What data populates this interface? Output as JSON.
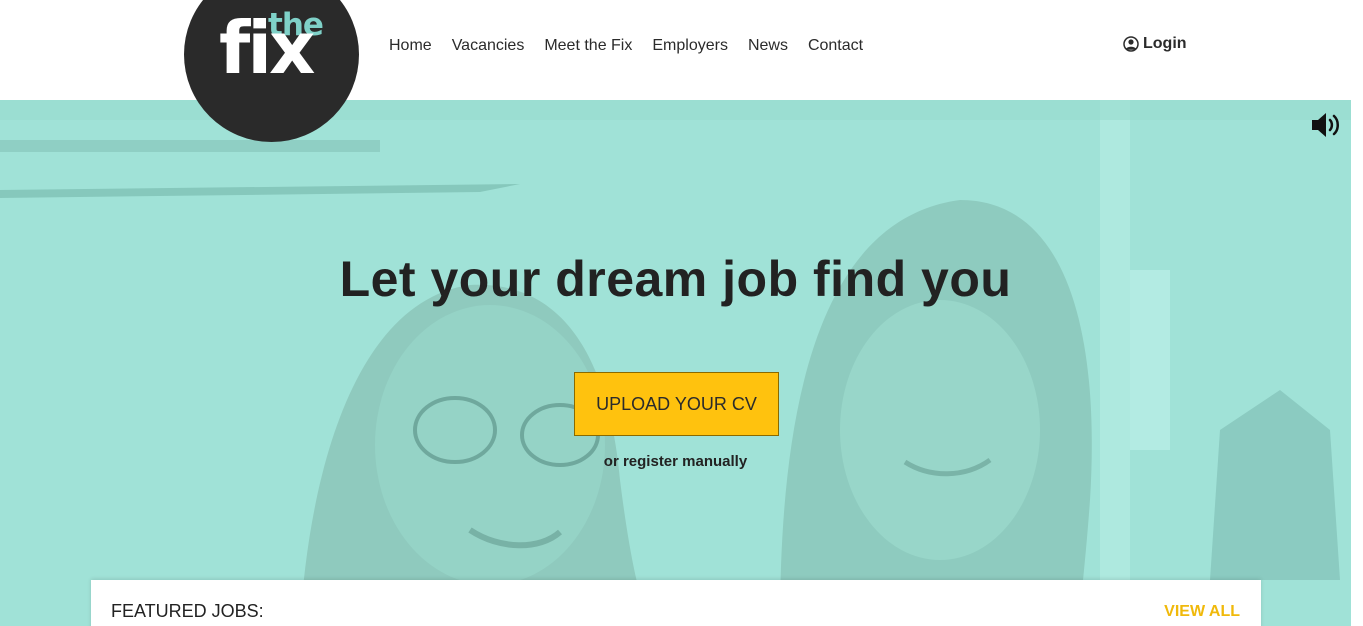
{
  "brand": {
    "logo_word_small": "the",
    "logo_word_large": "fix"
  },
  "nav": {
    "items": [
      {
        "label": "Home"
      },
      {
        "label": "Vacancies"
      },
      {
        "label": "Meet the Fix"
      },
      {
        "label": "Employers"
      },
      {
        "label": "News"
      },
      {
        "label": "Contact"
      }
    ]
  },
  "header": {
    "login_label": "Login",
    "login_icon": "user-circle-icon"
  },
  "hero": {
    "headline": "Let your dream job find you",
    "cta_label": "UPLOAD YOUR CV",
    "secondary_link": "or register manually",
    "sound_icon": "volume-icon",
    "overlay_color": "#a0e2d7"
  },
  "featured": {
    "title": "FEATURED JOBS:",
    "view_all_label": "VIEW ALL"
  },
  "colors": {
    "accent_yellow": "#ffc20e",
    "logo_dark": "#2a2a2a",
    "logo_teal": "#7fd1c8",
    "view_all": "#f0b90b"
  }
}
